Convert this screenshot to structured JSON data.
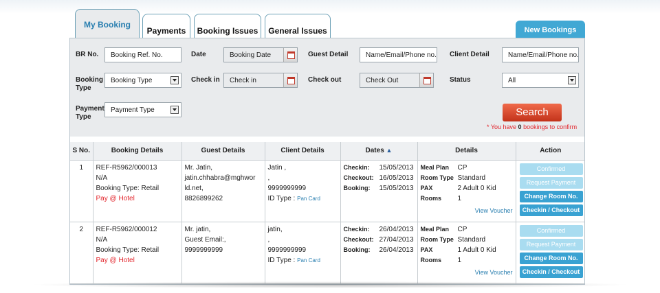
{
  "tabs": [
    {
      "label": "My Booking",
      "active": true
    },
    {
      "label": "Payments",
      "active": false
    },
    {
      "label": "Booking Issues",
      "active": false
    },
    {
      "label": "General Issues",
      "active": false
    }
  ],
  "new_bookings_label": "New Bookings",
  "filters": {
    "br_no": {
      "label": "BR No.",
      "placeholder": "Booking Ref. No."
    },
    "date": {
      "label": "Date",
      "placeholder": "Booking Date"
    },
    "guest_detail": {
      "label": "Guest Detail",
      "placeholder": "Name/Email/Phone no."
    },
    "client_detail": {
      "label": "Client Detail",
      "placeholder": "Name/Email/Phone no."
    },
    "booking_type": {
      "label_line1": "Booking",
      "label_line2": "Type",
      "value": "Booking Type"
    },
    "check_in": {
      "label": "Check in",
      "placeholder": "Check in"
    },
    "check_out": {
      "label": "Check out",
      "placeholder": "Check Out"
    },
    "status": {
      "label": "Status",
      "value": "All"
    },
    "payment_type": {
      "label_line1": "Payment",
      "label_line2": "Type",
      "value": "Payment Type"
    }
  },
  "search_label": "Search",
  "note": {
    "prefix": "* You have ",
    "count": "0",
    "suffix": " bookings to confirm"
  },
  "columns": [
    "S No.",
    "Booking Details",
    "Guest Details",
    "Client Details",
    "Dates",
    "Details",
    "Action"
  ],
  "sort_icon": "triangle-up-icon",
  "rows": [
    {
      "sno": "1",
      "ref": "REF-R5962/000013",
      "na": "N/A",
      "booking_type": "Booking Type: Retail",
      "pay": "Pay @ Hotel",
      "guest_line1": "Mr. Jatin,",
      "guest_line2": "jatin.chhabra@mghwor",
      "guest_line3": "ld.net,",
      "guest_line4": "8826899262",
      "client_line1": "Jatin ,",
      "client_line2": ",",
      "client_line3": "9999999999",
      "id_type_label": "ID Type :",
      "id_type_value": "Pan Card",
      "checkin_label": "Checkin:",
      "checkin": "15/05/2013",
      "checkout_label": "Checkout:",
      "checkout": "16/05/2013",
      "booking_label": "Booking:",
      "booking": "15/05/2013",
      "meal_label": "Meal Plan",
      "meal": "CP",
      "room_type_label": "Room Type",
      "room_type": "Standard",
      "pax_label": "PAX",
      "pax": "2 Adult 0 Kid",
      "rooms_label": "Rooms",
      "rooms": "1",
      "voucher": "View Voucher",
      "actions": [
        "Confirmed",
        "Request Payment",
        "Change Room No.",
        "Checkin / Checkout"
      ]
    },
    {
      "sno": "2",
      "ref": "REF-R5962/000012",
      "na": "N/A",
      "booking_type": "Booking Type: Retail",
      "pay": "Pay @ Hotel",
      "guest_line1": "Mr. jatin,",
      "guest_line2": "Guest Email:,",
      "guest_line3": "9999999999",
      "guest_line4": "",
      "client_line1": "jatin,",
      "client_line2": ",",
      "client_line3": "9999999999",
      "id_type_label": "ID Type :",
      "id_type_value": "Pan Card",
      "checkin_label": "Checkin:",
      "checkin": "26/04/2013",
      "checkout_label": "Checkout:",
      "checkout": "27/04/2013",
      "booking_label": "Booking:",
      "booking": "26/04/2013",
      "meal_label": "Meal Plan",
      "meal": "CP",
      "room_type_label": "Room Type",
      "room_type": "Standard",
      "pax_label": "PAX",
      "pax": "1 Adult 0 Kid",
      "rooms_label": "Rooms",
      "rooms": "1",
      "voucher": "View Voucher",
      "actions": [
        "Confirmed",
        "Request Payment",
        "Change Room No.",
        "Checkin / Checkout"
      ]
    }
  ]
}
